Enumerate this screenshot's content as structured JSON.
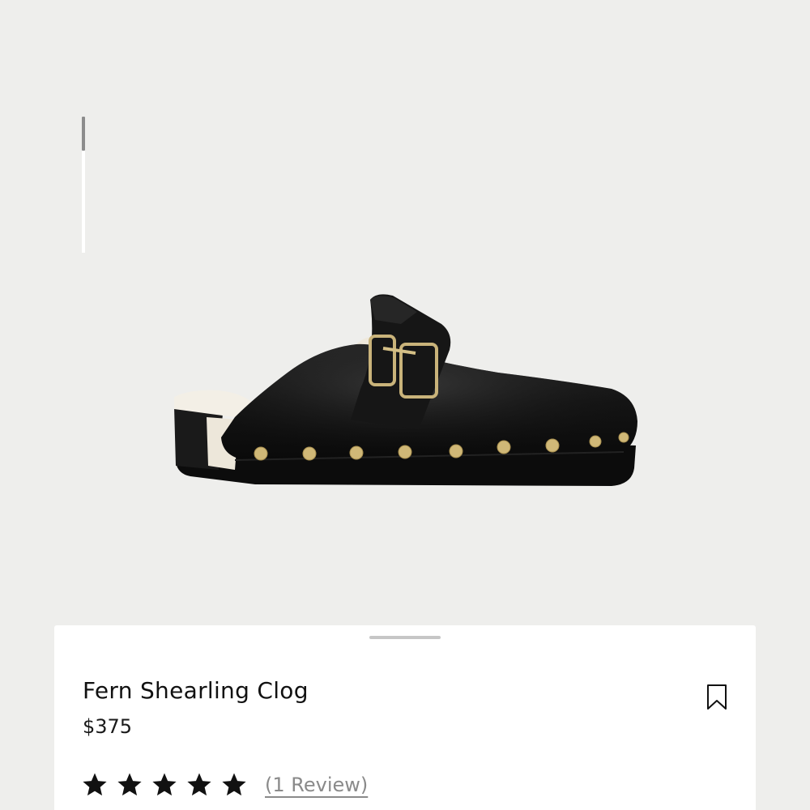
{
  "gallery": {
    "image_alt": "Black leather shearling-lined clog with gold buckle and studs",
    "scroll_position": 0.25
  },
  "product": {
    "name": "Fern Shearling Clog",
    "price": "$375",
    "rating": 5,
    "review_link": "(1 Review)"
  },
  "icons": {
    "bookmark": "bookmark-icon",
    "star": "star-icon"
  },
  "colors": {
    "background": "#eeeeec",
    "sheet": "#ffffff",
    "text": "#111111",
    "muted": "#8a8a8a",
    "gold": "#c9a866"
  }
}
